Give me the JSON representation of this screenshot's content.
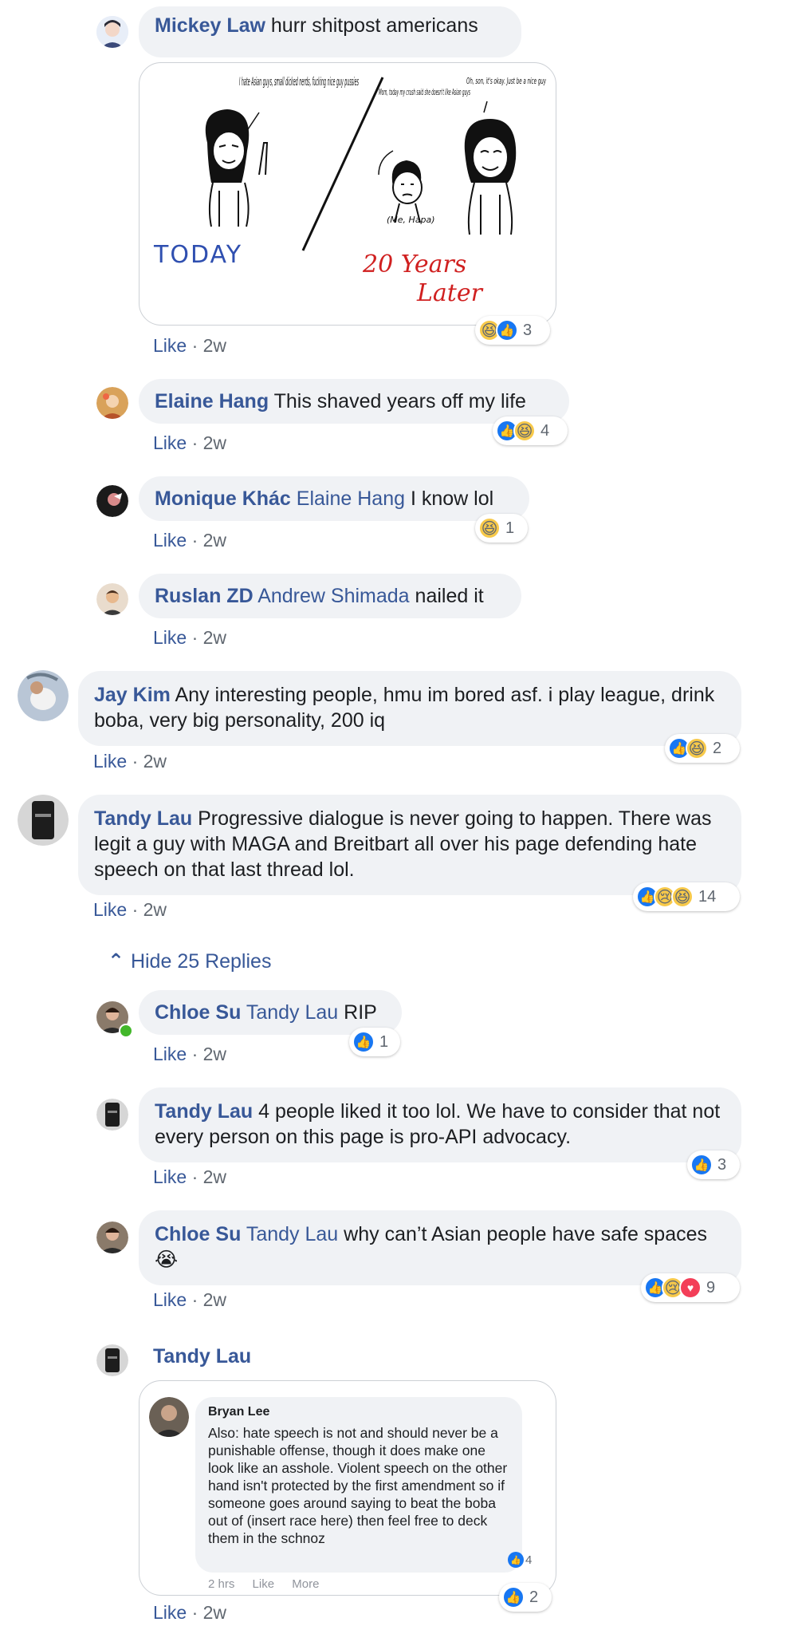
{
  "comments": [
    {
      "name": "Mickey Law",
      "text": "hurr shitpost americans",
      "meta_like": "Like",
      "meta_time": "· 2w",
      "reaction_count": "3"
    },
    {
      "name": "Elaine Hang",
      "text": "This shaved years off my life",
      "meta_like": "Like",
      "meta_time": "· 2w",
      "reaction_count": "4"
    },
    {
      "name": "Monique Khác",
      "tag": "Elaine Hang",
      "text": "I know lol",
      "meta_like": "Like",
      "meta_time": "· 2w",
      "reaction_count": "1"
    },
    {
      "name": "Ruslan ZD",
      "tag": "Andrew Shimada",
      "text": "nailed it",
      "meta_like": "Like",
      "meta_time": "· 2w"
    },
    {
      "name": "Jay Kim",
      "text": "Any interesting people, hmu im bored asf. i play league, drink boba, very big personality, 200 iq",
      "meta_like": "Like",
      "meta_time": "· 2w",
      "reaction_count": "2"
    },
    {
      "name": "Tandy Lau",
      "text": "Progressive dialogue is never going to happen. There was legit a guy with MAGA and Breitbart all over his page defending hate speech on that last thread lol.",
      "meta_like": "Like",
      "meta_time": "· 2w",
      "reaction_count": "14"
    },
    {
      "name": "Chloe Su",
      "tag": "Tandy Lau",
      "text": "RIP",
      "meta_like": "Like",
      "meta_time": "· 2w",
      "reaction_count": "1"
    },
    {
      "name": "Tandy Lau",
      "text": "4 people liked it too lol. We have to consider that not every person on this page is pro-API advocacy.",
      "meta_like": "Like",
      "meta_time": "· 2w",
      "reaction_count": "3"
    },
    {
      "name": "Chloe Su",
      "tag": "Tandy Lau",
      "text": "why can’t Asian people have safe spaces 😭",
      "meta_like": "Like",
      "meta_time": "· 2w",
      "reaction_count": "9"
    },
    {
      "name": "Tandy Lau",
      "meta_like": "Like",
      "meta_time": "· 2w",
      "reaction_count": "2"
    }
  ],
  "hide_replies": "Hide 25 Replies",
  "meme": {
    "left_quote": "I hate Asian guys, small dicked nerds, fucking nice guy pussies",
    "mid_quote": "Mom, today my crush said she doesn't like Asian guys",
    "right_quote": "Oh, son, it's okay. Just be a nice guy",
    "caption_me": "(Me, Hapa)",
    "today": "TODAY",
    "later_1": "20 Years",
    "later_2": "Later"
  },
  "screenshot_card": {
    "author": "Bryan Lee",
    "text": "Also: hate speech is not and should never be a punishable offense, though it does make one look like an asshole. Violent speech on the other hand isn't protected by the first amendment so if someone goes around saying to beat the boba out of (insert race here) then feel free to deck them in the schnoz",
    "time": "2 hrs",
    "like": "Like",
    "more": "More",
    "reaction_count": "4"
  },
  "colors": {
    "link": "#385898",
    "bubble": "#f0f2f5",
    "meta": "#606770",
    "like_blue": "#1877f2",
    "haha_yellow": "#f7c94a",
    "love_red": "#f33e58"
  }
}
